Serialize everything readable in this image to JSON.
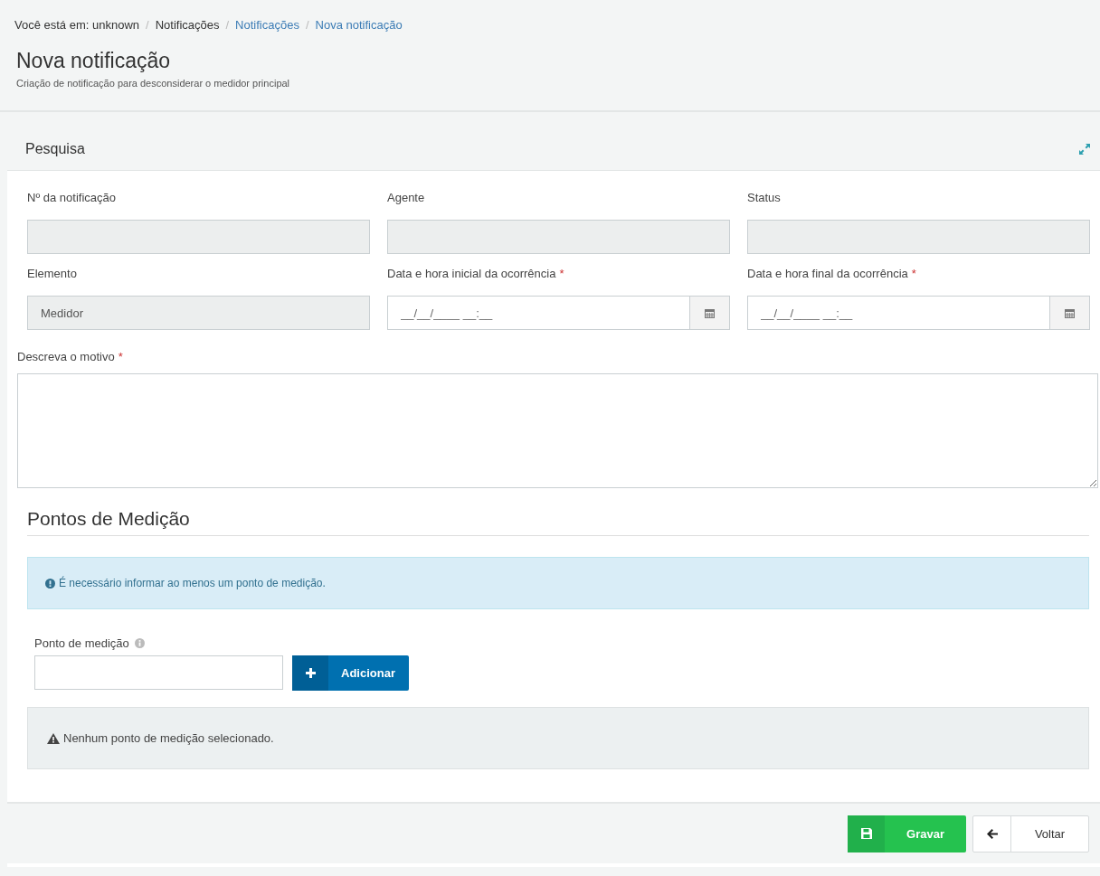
{
  "breadcrumb": {
    "prefix": "Você está em: unknown",
    "items": [
      {
        "separator": "/",
        "label": "Notificações",
        "link": false
      },
      {
        "separator": "/",
        "label": "Notificações",
        "link": true
      },
      {
        "separator": "/",
        "label": "Nova notificação",
        "link": true
      }
    ]
  },
  "page": {
    "title": "Nova notificação",
    "subtitle": "Criação de notificação para desconsiderar o medidor principal"
  },
  "panel": {
    "title": "Pesquisa",
    "fields": [
      {
        "label": "Nº da notificação",
        "kind": "readonly"
      },
      {
        "label": "Agente",
        "kind": "readonly"
      },
      {
        "label": "Status",
        "kind": "readonly"
      },
      {
        "label": "Elemento",
        "kind": "readonly",
        "value": "Medidor"
      },
      {
        "label": "Data e hora inicial da ocorrência",
        "required_mark": "*",
        "kind": "date",
        "placeholder": "__/__/____ __:__"
      },
      {
        "label": "Data e hora final da ocorrência",
        "required_mark": "*",
        "kind": "date",
        "placeholder": "__/__/____ __:__"
      }
    ],
    "reason": {
      "label": "Descreva o motivo",
      "required_mark": "*"
    },
    "section_title": "Pontos de Medição",
    "info_alert": "É necessário informar ao menos um ponto de medição.",
    "point_label": "Ponto de medição",
    "add_button": "Adicionar",
    "warning_alert": "Nenhum ponto de medição selecionado."
  },
  "footer": {
    "buttons": [
      {
        "label": "Gravar",
        "kind": "save"
      },
      {
        "label": "Voltar",
        "kind": "back"
      }
    ]
  }
}
